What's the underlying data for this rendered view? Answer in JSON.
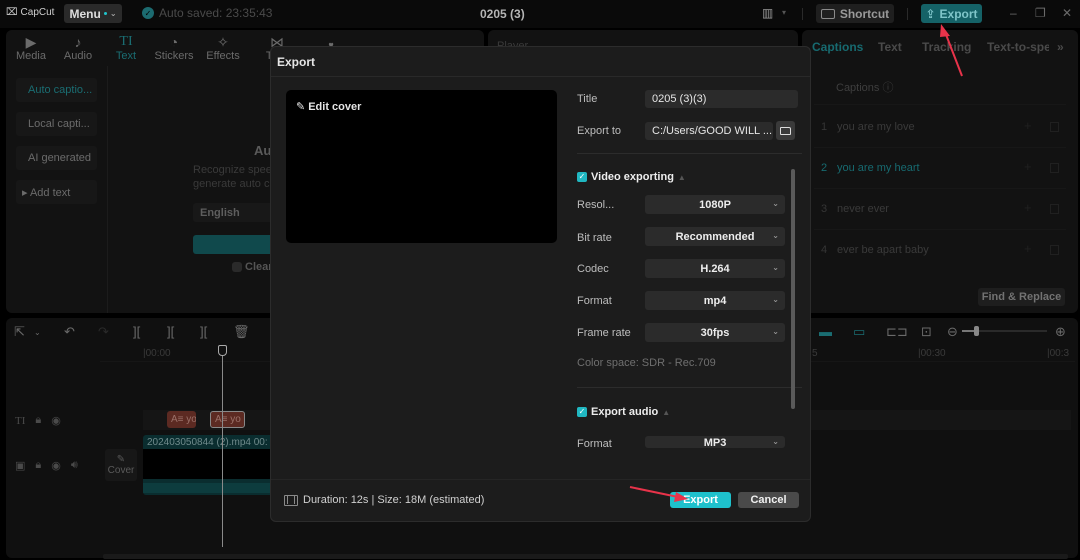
{
  "app": {
    "logo": "CapCut",
    "menu_label": "Menu",
    "autosave": "Auto saved: 23:35:43",
    "project_title": "0205 (3)",
    "shortcut_label": "Shortcut",
    "export_label": "Export",
    "accent": "#1ec1cc"
  },
  "left_tabs": [
    {
      "icon": "media-icon",
      "glyph": "▶",
      "label": "Media"
    },
    {
      "icon": "audio-icon",
      "glyph": "♪",
      "label": "Audio"
    },
    {
      "icon": "text-icon",
      "glyph": "TI",
      "label": "Text",
      "active": true
    },
    {
      "icon": "stickers-icon",
      "glyph": "◔",
      "label": "Stickers"
    },
    {
      "icon": "effects-icon",
      "glyph": "✧",
      "label": "Effects"
    },
    {
      "icon": "transitions-icon",
      "glyph": "⋈",
      "label": "Tran"
    },
    {
      "icon": "filters-icon",
      "glyph": "☘",
      "label": ""
    },
    {
      "icon": "adjust-icon",
      "glyph": "⚌",
      "label": ""
    }
  ],
  "text_sidebar": [
    {
      "label": "Auto captio...",
      "active": true
    },
    {
      "label": "Local capti..."
    },
    {
      "label": "AI generated"
    },
    {
      "label": "▸ Add text"
    }
  ],
  "auto_caption": {
    "heading": "Au",
    "desc_line1": "Recognize spee",
    "desc_line2": "generate auto c",
    "language": "English",
    "clear_label": "Clear"
  },
  "player": {
    "label": "Player"
  },
  "right_panel": {
    "tabs": [
      {
        "label": "Captions",
        "active": true
      },
      {
        "label": "Text"
      },
      {
        "label": "Tracking"
      },
      {
        "label": "Text-to-spe"
      }
    ],
    "more": "»",
    "captions_header": "Captions ⓘ",
    "captions": [
      {
        "num": "1",
        "text": "you are my love"
      },
      {
        "num": "2",
        "text": "you are my heart",
        "active": true
      },
      {
        "num": "3",
        "text": "never ever"
      },
      {
        "num": "4",
        "text": "ever be apart baby"
      }
    ],
    "find_replace": "Find & Replace"
  },
  "timeline": {
    "ticks": [
      "|00:00",
      "5",
      "|00:30",
      "|00:3"
    ],
    "text_clips": [
      "A≡ yo",
      "A≡ yo"
    ],
    "video_clip_name": "202403050844 (2).mp4  00:",
    "cover_label": "Cover"
  },
  "export_dialog": {
    "title": "Export",
    "edit_cover": "Edit cover",
    "fields": {
      "title_label": "Title",
      "title_value": "0205 (3)(3)",
      "export_to_label": "Export to",
      "export_to_value": "C:/Users/GOOD WILL ..."
    },
    "video": {
      "heading": "Video exporting",
      "checked": true,
      "rows": [
        {
          "label": "Resol...",
          "value": "1080P"
        },
        {
          "label": "Bit rate",
          "value": "Recommended"
        },
        {
          "label": "Codec",
          "value": "H.264"
        },
        {
          "label": "Format",
          "value": "mp4"
        },
        {
          "label": "Frame rate",
          "value": "30fps"
        }
      ],
      "color_space": "Color space: SDR - Rec.709"
    },
    "audio": {
      "heading": "Export audio",
      "checked": true,
      "format_label": "Format",
      "format_value": "MP3"
    },
    "footer_info": "Duration: 12s | Size: 18M (estimated)",
    "export_button": "Export",
    "cancel_button": "Cancel"
  }
}
